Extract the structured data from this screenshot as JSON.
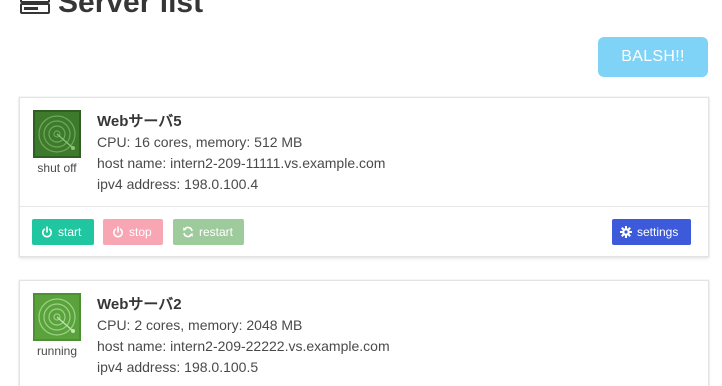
{
  "header": {
    "title": "Server list"
  },
  "toolbar": {
    "balsh_label": "BALSH!!"
  },
  "servers": [
    {
      "name": "Webサーバ5",
      "status": "shut off",
      "cpu_memory": "CPU: 16 cores, memory: 512 MB",
      "host": "host name: intern2-209-11111.vs.example.com",
      "ipv4": "ipv4 address: 198.0.100.4",
      "actions": {
        "start": "start",
        "stop": "stop",
        "restart": "restart",
        "settings": "settings"
      }
    },
    {
      "name": "Webサーバ2",
      "status": "running",
      "cpu_memory": "CPU: 2 cores, memory: 2048 MB",
      "host": "host name: intern2-209-22222.vs.example.com",
      "ipv4": "ipv4 address: 198.0.100.5"
    }
  ],
  "colors": {
    "start": "#1fc6a0",
    "stop": "#f8a6b4",
    "restart": "#9dcb9b",
    "settings": "#3c5ad9",
    "balsh": "#7fd3f7",
    "thumb_off": "#2f5f22",
    "thumb_on": "#5aa33c"
  },
  "icons": {
    "title": "server-stack-icon",
    "start": "power-icon",
    "stop": "power-icon",
    "restart": "refresh-icon",
    "settings": "gear-icon"
  }
}
